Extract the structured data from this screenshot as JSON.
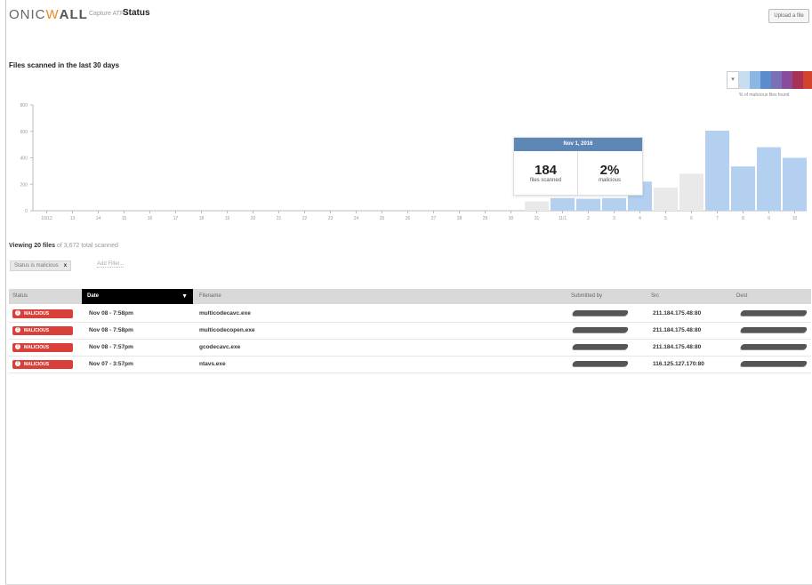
{
  "header": {
    "logo_prefix": "ONIC",
    "logo_accent": "W",
    "logo_suffix": "ALL",
    "breadcrumb": "Capture ATP /",
    "page_title": "Status",
    "upload_label": "Upload a file"
  },
  "chart_section": {
    "title": "Files scanned in the last 30 days",
    "legend": {
      "label": "% of malicious files found",
      "colors": [
        "#c8ddf0",
        "#8cb7e3",
        "#5b8ccc",
        "#7a70b5",
        "#8a4b9a",
        "#a83255",
        "#d3442f"
      ]
    }
  },
  "chart_data": {
    "type": "bar",
    "categories": [
      "10/12",
      "13",
      "14",
      "15",
      "16",
      "17",
      "18",
      "19",
      "20",
      "21",
      "22",
      "23",
      "24",
      "25",
      "26",
      "27",
      "28",
      "29",
      "30",
      "31",
      "11/1",
      "2",
      "3",
      "4",
      "5",
      "6",
      "7",
      "8",
      "9",
      "10"
    ],
    "values": [
      0,
      0,
      0,
      0,
      0,
      0,
      0,
      0,
      0,
      0,
      0,
      0,
      0,
      0,
      0,
      0,
      0,
      0,
      0,
      70,
      95,
      90,
      95,
      220,
      175,
      280,
      605,
      335,
      480,
      400
    ],
    "colors": [
      "#e9e9e9",
      "#e9e9e9",
      "#e9e9e9",
      "#e9e9e9",
      "#e9e9e9",
      "#e9e9e9",
      "#e9e9e9",
      "#e9e9e9",
      "#e9e9e9",
      "#e9e9e9",
      "#e9e9e9",
      "#e9e9e9",
      "#e9e9e9",
      "#e9e9e9",
      "#e9e9e9",
      "#e9e9e9",
      "#e9e9e9",
      "#e9e9e9",
      "#e9e9e9",
      "#e9e9e9",
      "#b3d0f0",
      "#b3d0f0",
      "#b3d0f0",
      "#b3d0f0",
      "#e9e9e9",
      "#e9e9e9",
      "#b3d0f0",
      "#b3d0f0",
      "#b3d0f0",
      "#b3d0f0"
    ],
    "y_ticks": [
      0,
      200,
      400,
      600,
      800
    ],
    "ylim": [
      0,
      800
    ],
    "grid": false
  },
  "tooltip": {
    "date": "Nov 1, 2016",
    "files_value": "184",
    "files_label": "files scanned",
    "malicious_value": "2%",
    "malicious_label": "malicious"
  },
  "summary": {
    "viewing_prefix": "Viewing 20 files",
    "viewing_suffix": "of 3,672 total scanned",
    "filter_chip": "Status is malicious",
    "filter_remove": "x",
    "add_filter": "Add Filter..."
  },
  "table": {
    "columns": {
      "status": "Status",
      "date": "Date",
      "filename": "Filename",
      "submitted": "Submitted by",
      "src": "Src",
      "dest": "Dest"
    },
    "badge_label": "MALICIOUS",
    "rows": [
      {
        "date": "Nov 08 - 7:58pm",
        "filename": "multicodecavc.exe",
        "src": "211.184.175.48:80"
      },
      {
        "date": "Nov 08 - 7:58pm",
        "filename": "multicodecopen.exe",
        "src": "211.184.175.48:80"
      },
      {
        "date": "Nov 08 - 7:57pm",
        "filename": "gcodecavc.exe",
        "src": "211.184.175.48:80"
      },
      {
        "date": "Nov 07 - 3:57pm",
        "filename": "ntavs.exe",
        "src": "116.125.127.170:80"
      }
    ]
  }
}
